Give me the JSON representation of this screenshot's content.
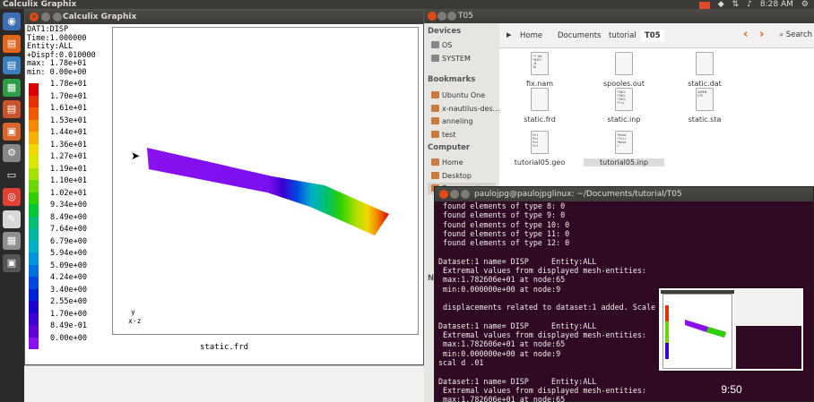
{
  "top_panel": {
    "app_title": "Calculix Graphix",
    "clock": "8:28 AM",
    "icons": [
      "indicator-red",
      "dropbox-icon",
      "network-icon",
      "sound-icon",
      "gear-icon"
    ]
  },
  "launcher": {
    "items": [
      {
        "name": "ubuntu-dash-icon",
        "color": "#3c6fb2"
      },
      {
        "name": "files-icon",
        "color": "#e2661a"
      },
      {
        "name": "writer-icon",
        "color": "#3a7ebf"
      },
      {
        "name": "calc-icon",
        "color": "#2e9e46"
      },
      {
        "name": "impress-icon",
        "color": "#c9532a"
      },
      {
        "name": "software-center-icon",
        "color": "#d8662a"
      },
      {
        "name": "settings-icon",
        "color": "#888888"
      },
      {
        "name": "terminal-icon",
        "color": "#2b2b2b"
      },
      {
        "name": "chrome-icon",
        "color": "#e34133"
      },
      {
        "name": "text-editor-icon",
        "color": "#d8d8d8"
      },
      {
        "name": "app-icon",
        "color": "#8f8f8f"
      },
      {
        "name": "workspace-icon",
        "color": "#555555"
      }
    ]
  },
  "cgx": {
    "window_title": "Calculix Graphix",
    "info_lines": [
      "DAT1:DISP",
      "Time:1.000000",
      "Entity:ALL",
      "+Dispf:0.010000",
      "max: 1.78e+01",
      "min: 0.00e+00"
    ],
    "legend": [
      {
        "label": "1.78e+01",
        "color": "#d90000"
      },
      {
        "label": "1.70e+01",
        "color": "#e63000"
      },
      {
        "label": "1.61e+01",
        "color": "#f05a00"
      },
      {
        "label": "1.53e+01",
        "color": "#f58800"
      },
      {
        "label": "1.44e+01",
        "color": "#f5b000"
      },
      {
        "label": "1.36e+01",
        "color": "#f0d800"
      },
      {
        "label": "1.27e+01",
        "color": "#d8e800"
      },
      {
        "label": "1.19e+01",
        "color": "#a8e000"
      },
      {
        "label": "1.10e+01",
        "color": "#6cd800"
      },
      {
        "label": "1.02e+01",
        "color": "#2ed000"
      },
      {
        "label": "9.34e+00",
        "color": "#00c830"
      },
      {
        "label": "8.49e+00",
        "color": "#00c070"
      },
      {
        "label": "7.64e+00",
        "color": "#00b8a0"
      },
      {
        "label": "6.79e+00",
        "color": "#00b0c8"
      },
      {
        "label": "5.94e+00",
        "color": "#0094d8"
      },
      {
        "label": "5.09e+00",
        "color": "#0070e0"
      },
      {
        "label": "4.24e+00",
        "color": "#0048e0"
      },
      {
        "label": "3.40e+00",
        "color": "#0020d8"
      },
      {
        "label": "2.55e+00",
        "color": "#1800d0"
      },
      {
        "label": "1.70e+00",
        "color": "#3c00d0"
      },
      {
        "label": "8.49e-01",
        "color": "#6000d8"
      },
      {
        "label": "0.00e+00",
        "color": "#8a10f0"
      }
    ],
    "axes_label": "y\nx-z",
    "filename": "static.frd"
  },
  "nautilus": {
    "window_title": "T05",
    "sidebar": {
      "devices_heading": "Devices",
      "devices": [
        "OS",
        "SYSTEM"
      ],
      "bookmarks_heading": "Bookmarks",
      "bookmarks": [
        "Ubuntu One",
        "x-nautilus-des...",
        "anneling",
        "test"
      ],
      "computer_heading": "Computer",
      "computer": [
        "Home",
        "Desktop",
        "Documents"
      ],
      "network_heading": "Ne"
    },
    "breadcrumbs": [
      "Home",
      "Documents",
      "tutorial",
      "T05"
    ],
    "search_label": "Search",
    "files": [
      {
        "name": "fix.nam",
        "preview": "** Na\n*NSET\n,N\n16"
      },
      {
        "name": "spooles.out",
        "preview": ""
      },
      {
        "name": "static.dat",
        "preview": ""
      },
      {
        "name": "static.frd",
        "preview": ""
      },
      {
        "name": "static.inp",
        "preview": "*INCL\n*INCL\n*INCL\n*Fix"
      },
      {
        "name": "static.sta",
        "preview": "SUMMA\nSTE"
      },
      {
        "name": "tutorial05.geo",
        "preview": "Pnt\nPnt\nPnt\nPnt"
      },
      {
        "name": "tutorial05.inp",
        "preview": "*Head\n*Tutr\n*Node\n1"
      }
    ]
  },
  "terminal": {
    "window_title": "paulojpg@paulojpglinux: ~/Documents/tutorial/T05",
    "lines": [
      " found elements of type 8: 0",
      " found elements of type 9: 0",
      " found elements of type 10: 0",
      " found elements of type 11: 0",
      " found elements of type 12: 0",
      "",
      "Dataset:1 name= DISP     Entity:ALL",
      " Extremal values from displayed mesh-entities:",
      " max:1.782606e+01 at node:65",
      " min:0.000000e+00 at node:9",
      "",
      " displacements related to dataset:1 added. Scale",
      "",
      "Dataset:1 name= DISP     Entity:ALL",
      " Extremal values from displayed mesh-entities:",
      " max:1.782606e+01 at node:65",
      " min:0.000000e+00 at node:9",
      "scal d .01",
      "",
      "Dataset:1 name= DISP     Entity:ALL",
      " Extremal values from displayed mesh-entities:",
      " max:1.782606e+01 at node:65"
    ]
  },
  "overlay": {
    "timestamp": "9:50"
  }
}
